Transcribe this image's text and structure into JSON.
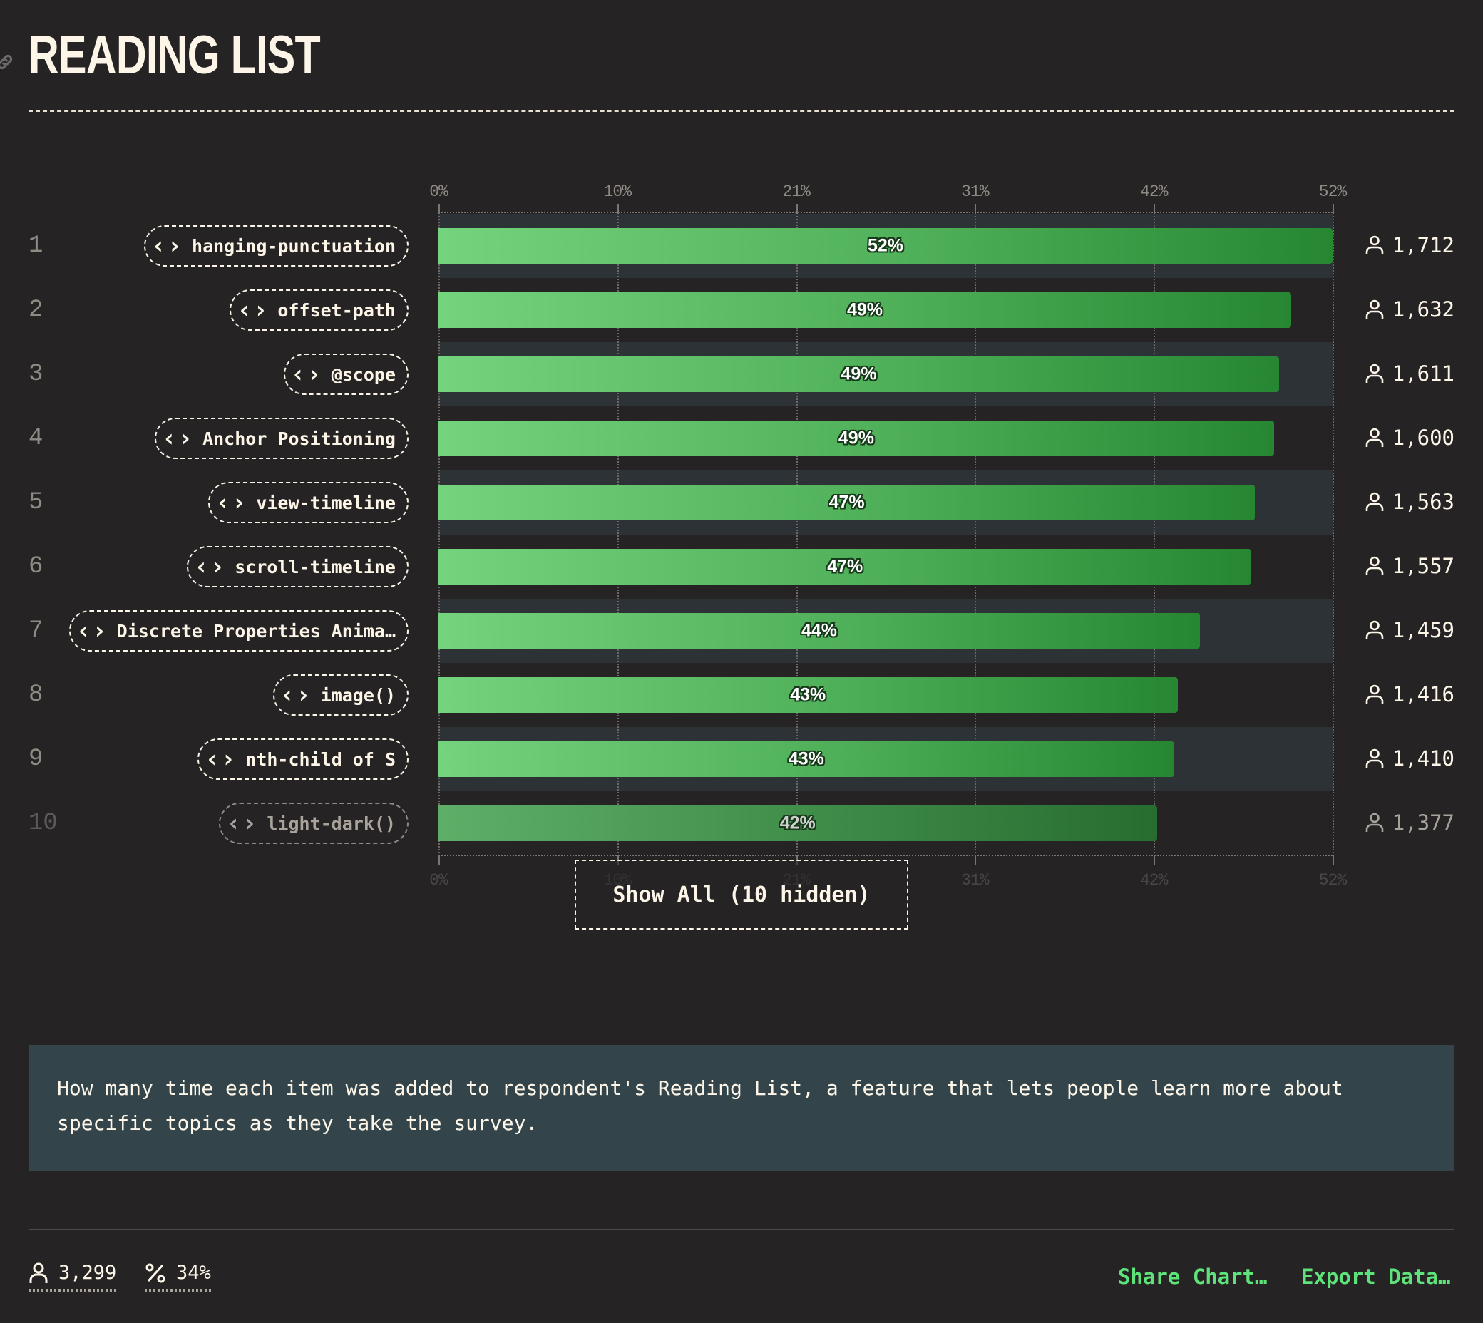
{
  "header": {
    "title": "READING LIST",
    "link_icon": "link-icon"
  },
  "chart_data": {
    "type": "bar",
    "orientation": "horizontal",
    "title": "Reading List",
    "xlabel": "",
    "ylabel": "",
    "unit": "percent of respondents",
    "xlim": [
      0,
      51.9
    ],
    "ticks": [
      "0%",
      "10%",
      "21%",
      "31%",
      "42%",
      "52%"
    ],
    "tick_values": [
      0,
      10.38,
      20.76,
      31.14,
      41.52,
      51.9
    ],
    "grid": true,
    "total_respondents": 3299,
    "rows": [
      {
        "rank": "1",
        "label": "hanging-punctuation",
        "value": 51.9,
        "value_label": "52%",
        "count": "1,712",
        "dim": false
      },
      {
        "rank": "2",
        "label": "offset-path",
        "value": 49.5,
        "value_label": "49%",
        "count": "1,632",
        "dim": false
      },
      {
        "rank": "3",
        "label": "@scope",
        "value": 48.8,
        "value_label": "49%",
        "count": "1,611",
        "dim": false
      },
      {
        "rank": "4",
        "label": "Anchor Positioning",
        "value": 48.5,
        "value_label": "49%",
        "count": "1,600",
        "dim": false
      },
      {
        "rank": "5",
        "label": "view-timeline",
        "value": 47.4,
        "value_label": "47%",
        "count": "1,563",
        "dim": false
      },
      {
        "rank": "6",
        "label": "scroll-timeline",
        "value": 47.2,
        "value_label": "47%",
        "count": "1,557",
        "dim": false
      },
      {
        "rank": "7",
        "label": "Discrete Properties Anima…",
        "value": 44.2,
        "value_label": "44%",
        "count": "1,459",
        "dim": false
      },
      {
        "rank": "8",
        "label": "image()",
        "value": 42.9,
        "value_label": "43%",
        "count": "1,416",
        "dim": false
      },
      {
        "rank": "9",
        "label": "nth-child of S",
        "value": 42.7,
        "value_label": "43%",
        "count": "1,410",
        "dim": false
      },
      {
        "rank": "10",
        "label": "light-dark()",
        "value": 41.7,
        "value_label": "42%",
        "count": "1,377",
        "dim": true
      }
    ]
  },
  "show_all_label": "Show All (10 hidden)",
  "description": "How many time each item was added to respondent's Reading List, a feature that lets people learn more about specific topics as they take the survey.",
  "footer": {
    "respondents": "3,299",
    "percentage": "34%",
    "share_label": "Share Chart…",
    "export_label": "Export Data…"
  },
  "colors": {
    "background": "#262324",
    "text": "#fdf6e8",
    "accent": "#5ee27a",
    "bar_start": "#74d47e",
    "bar_end": "#268632",
    "stripe": "#2c3236",
    "description_bg": "#33454a"
  }
}
